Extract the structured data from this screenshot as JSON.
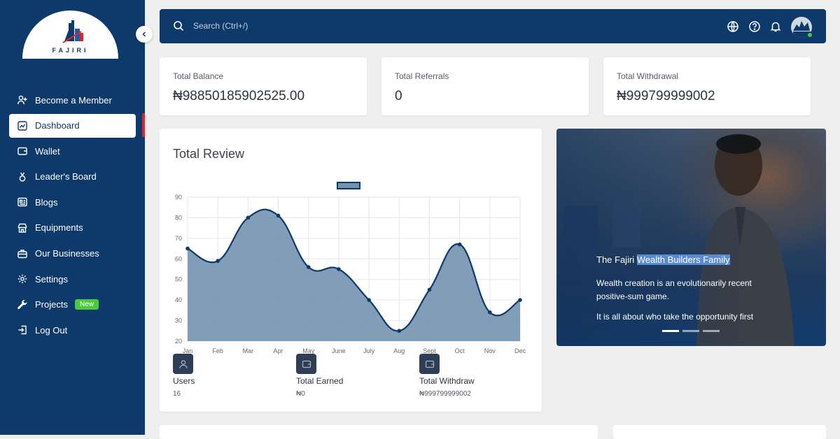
{
  "brand": {
    "logo_text": "FAJIRI"
  },
  "sidebar": {
    "items": [
      {
        "label": "Become a Member",
        "icon": "user-plus-icon"
      },
      {
        "label": "Dashboard",
        "icon": "chart-icon",
        "active": true
      },
      {
        "label": "Wallet",
        "icon": "wallet-icon"
      },
      {
        "label": "Leader's Board",
        "icon": "medal-icon"
      },
      {
        "label": "Blogs",
        "icon": "newspaper-icon"
      },
      {
        "label": "Equipments",
        "icon": "store-icon"
      },
      {
        "label": "Our Businesses",
        "icon": "briefcase-icon"
      },
      {
        "label": "Settings",
        "icon": "gear-icon"
      },
      {
        "label": "Projects",
        "icon": "wrench-icon",
        "badge": "New"
      },
      {
        "label": "Log Out",
        "icon": "logout-icon"
      }
    ]
  },
  "topbar": {
    "search_placeholder": "Search (Ctrl+/)"
  },
  "stats": [
    {
      "label": "Total Balance",
      "value": "₦98850185902525.00"
    },
    {
      "label": "Total Referrals",
      "value": "0"
    },
    {
      "label": "Total Withdrawal",
      "value": "₦999799999002"
    }
  ],
  "review": {
    "title": "Total Review",
    "summary": [
      {
        "label": "Users",
        "value": "16",
        "icon": "user-icon"
      },
      {
        "label": "Total Earned",
        "value": "₦0",
        "icon": "wallet-icon"
      },
      {
        "label": "Total Withdraw",
        "value": "₦999799999002",
        "icon": "wallet-icon"
      }
    ]
  },
  "chart_data": {
    "type": "area",
    "categories": [
      "Jan",
      "Feb",
      "Mar",
      "Apr",
      "May",
      "June",
      "July",
      "Aug",
      "Sept",
      "Oct",
      "Nov",
      "Dec"
    ],
    "series": [
      {
        "values": [
          65,
          59,
          80,
          81,
          56,
          55,
          40,
          25,
          45,
          67,
          34,
          40
        ]
      }
    ],
    "ylim": [
      20,
      90
    ],
    "yticks": [
      20,
      30,
      40,
      50,
      60,
      70,
      80,
      90
    ],
    "grid": true,
    "legend": "top-center",
    "fill_color": "#7392b0",
    "line_color": "#0d3a6b"
  },
  "hero": {
    "title_prefix": "The Fajiri ",
    "title_highlight": "Wealth Builders Family",
    "paragraph1": "Wealth creation is an evolutionarily recent positive-sum game.",
    "paragraph2": "It is all about who take the opportunity first"
  },
  "colors": {
    "primary": "#0d3a6b",
    "accent": "#e0242b",
    "badge": "#4cc93f"
  }
}
